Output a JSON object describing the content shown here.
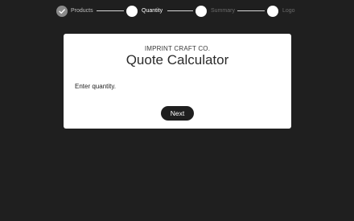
{
  "stepper": {
    "steps": [
      {
        "label": "Products",
        "state": "done"
      },
      {
        "label": "Quantity",
        "state": "current"
      },
      {
        "label": "Summary",
        "state": "upcoming"
      },
      {
        "label": "Logo",
        "state": "upcoming"
      }
    ]
  },
  "card": {
    "brand": "IMPRINT CRAFT CO.",
    "title": "Quote Calculator",
    "instruction": "Enter quantity.",
    "next_label": "Next"
  },
  "colors": {
    "background": "#1f1f1f",
    "card": "#ffffff",
    "button": "#1f1f1f",
    "done_step": "#8a8a8a"
  }
}
